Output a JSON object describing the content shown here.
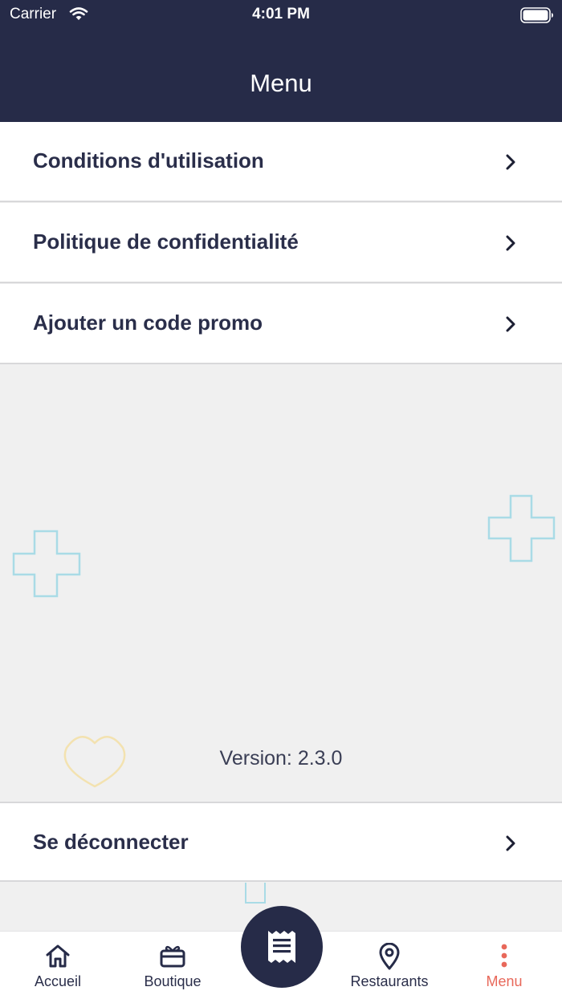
{
  "status_bar": {
    "carrier": "Carrier",
    "time": "4:01 PM",
    "icons": [
      "wifi-icon",
      "battery-icon"
    ]
  },
  "header": {
    "title": "Menu"
  },
  "menu_items": [
    {
      "label": "Conditions d'utilisation",
      "icon": "chevron-right-icon"
    },
    {
      "label": "Politique de confidentialité",
      "icon": "chevron-right-icon"
    },
    {
      "label": "Ajouter un code promo",
      "icon": "chevron-right-icon"
    }
  ],
  "version": "Version: 2.3.0",
  "logout": {
    "label": "Se déconnecter",
    "icon": "chevron-right-icon"
  },
  "tabbar": {
    "tabs": [
      {
        "label": "Accueil",
        "icon": "home-icon",
        "active": false
      },
      {
        "label": "Boutique",
        "icon": "gift-card-icon",
        "active": false
      },
      {
        "label": "Restaurants",
        "icon": "map-pin-icon",
        "active": false
      },
      {
        "label": "Menu",
        "icon": "more-vertical-icon",
        "active": true
      }
    ],
    "center_icon": "receipt-icon"
  },
  "colors": {
    "navy": "#262b48",
    "accent": "#e8685a",
    "background": "#f0f0f0",
    "deco_blue": "#a9dbe6",
    "deco_yellow": "#f3e2b0"
  }
}
